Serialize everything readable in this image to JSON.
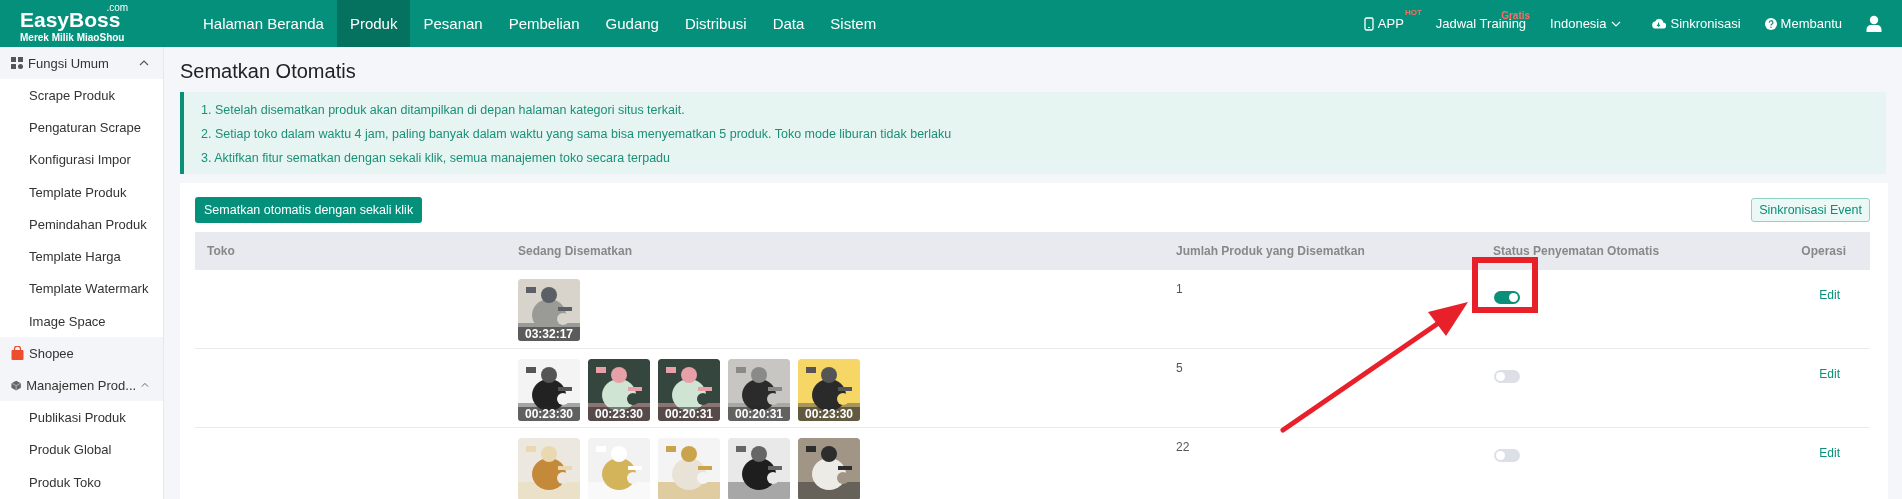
{
  "header": {
    "logo": {
      "name": "EasyBoss",
      "tld": ".com",
      "subtitle": "Merek Milik MiaoShou"
    },
    "nav": [
      {
        "label": "Halaman Beranda",
        "selected": false
      },
      {
        "label": "Produk",
        "selected": true
      },
      {
        "label": "Pesanan",
        "selected": false
      },
      {
        "label": "Pembelian",
        "selected": false
      },
      {
        "label": "Gudang",
        "selected": false
      },
      {
        "label": "Distribusi",
        "selected": false
      },
      {
        "label": "Data",
        "selected": false
      },
      {
        "label": "Sistem",
        "selected": false
      }
    ],
    "app": {
      "label": "APP",
      "badge": "HOT"
    },
    "training": {
      "label": "Jadwal Training",
      "badge": "Gratis"
    },
    "language": "Indonesia",
    "sync": "Sinkronisasi",
    "help": "Membantu"
  },
  "sidebar": {
    "items": [
      {
        "kind": "group",
        "label": "Fungsi Umum",
        "expanded": true,
        "children": [
          {
            "label": "Scrape Produk"
          },
          {
            "label": "Pengaturan Scrape"
          },
          {
            "label": "Konfigurasi Impor"
          },
          {
            "label": "Template Produk"
          },
          {
            "label": "Pemindahan Produk"
          },
          {
            "label": "Template Harga"
          },
          {
            "label": "Template Watermark"
          },
          {
            "label": "Image Space"
          }
        ]
      },
      {
        "kind": "link",
        "label": "Shopee"
      },
      {
        "kind": "group",
        "label": "Manajemen Prod...",
        "expanded": true,
        "children": [
          {
            "label": "Publikasi Produk"
          },
          {
            "label": "Produk Global"
          },
          {
            "label": "Produk Toko"
          }
        ]
      }
    ]
  },
  "page": {
    "title": "Sematkan Otomatis",
    "notes": [
      "1. Setelah disematkan produk akan ditampilkan di depan halaman kategori situs terkait.",
      "2. Setiap toko dalam waktu 4 jam, paling banyak dalam waktu yang sama bisa menyematkan 5 produk. Toko mode liburan tidak berlaku",
      "3. Aktifkan fitur sematkan dengan sekali klik, semua manajemen toko secara terpadu"
    ],
    "primary_button": "Sematkan otomatis dengan sekali klik",
    "secondary_button": "Sinkronisasi Event",
    "table": {
      "columns": [
        "Toko",
        "Sedang Disematkan",
        "Jumlah Produk yang Disematkan",
        "Status Penyematan Otomatis",
        "Operasi"
      ],
      "rows": [
        {
          "pinned": [
            {
              "time": "03:32:17"
            }
          ],
          "count": "1",
          "auto_pin": true,
          "action": "Edit"
        },
        {
          "pinned": [
            {
              "time": "00:23:30"
            },
            {
              "time": "00:23:30"
            },
            {
              "time": "00:20:31"
            },
            {
              "time": "00:20:31"
            },
            {
              "time": "00:23:30"
            }
          ],
          "count": "5",
          "auto_pin": false,
          "action": "Edit"
        },
        {
          "count": "22",
          "auto_pin": false,
          "action": "Edit"
        }
      ]
    }
  },
  "annotation": {
    "kind": "arrow-to-box"
  }
}
